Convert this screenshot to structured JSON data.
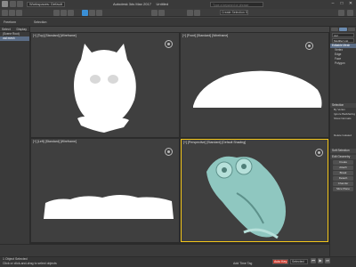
{
  "titlebar": {
    "workspace": "Workspaces: Default",
    "title": "Autodesk 3ds Max 2017",
    "doc": "Untitled",
    "search_placeholder": "Type a keyword or phrase"
  },
  "menubar": {
    "selection_set": "Create Selection Set"
  },
  "scene_explorer": {
    "tabs": [
      "Select",
      "Display"
    ],
    "rows": [
      "(Scene Root)",
      "owl mesh"
    ]
  },
  "viewports": {
    "top": "[+] [Top] [Standard] [Wireframe]",
    "front": "[+] [Front] [Standard] [Wireframe]",
    "left": "[+] [Left] [Standard] [Wireframe]",
    "perspective": "[+] [Perspective] [Standard] [Default Shading]"
  },
  "command_panel": {
    "header": "owl",
    "modifier_list": "Modifier List",
    "stack": [
      "Editable Mesh",
      "Vertex",
      "Edge",
      "Face",
      "Polygon"
    ],
    "rollouts": {
      "selection": "Selection",
      "by_vertex": "By Vertex",
      "ignore_backfacing": "Ignore Backfacing",
      "show_normals": "Show Normals",
      "delete_isolated": "Delete Isolated",
      "soft_selection": "Soft Selection",
      "edit_geometry": "Edit Geometry"
    },
    "buttons": [
      "Create",
      "Attach",
      "Break",
      "Detach",
      "Chamfer",
      "Slice Plane"
    ]
  },
  "status": {
    "selected": "1 Object Selected",
    "prompt": "Click or click-and-drag to select objects",
    "add_time_tag": "Add Time Tag",
    "auto_key": "Auto Key",
    "set_key": "Set Key",
    "selected_dropdown": "Selected"
  },
  "colors": {
    "model": "#ffffff",
    "shaded_model": "#8fc7c0",
    "active_border": "#f2c51a",
    "accent": "#3a8fd6",
    "auto_key": "#c83b2e"
  }
}
